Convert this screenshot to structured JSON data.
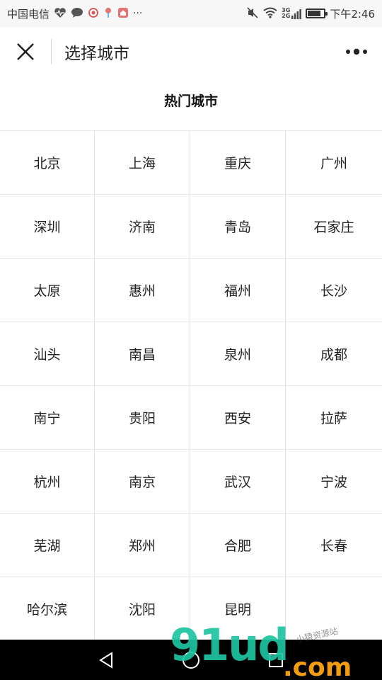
{
  "status_bar": {
    "carrier": "中国电信",
    "icons_left": [
      "heart-rate-icon",
      "chat-bubble-icon",
      "weibo-icon",
      "map-pin-icon",
      "home-app-icon",
      "more-dots-icon"
    ],
    "ellipsis": "···",
    "icons_right": [
      "mute-icon",
      "wifi-icon",
      "signal-3g-4g-icon",
      "battery-icon"
    ],
    "signal_label_top": "3G",
    "signal_label_bottom": "2G",
    "battery_level": 0.8,
    "time": "下午2:46"
  },
  "header": {
    "title": "选择城市",
    "close_icon": "close-icon",
    "more_icon": "more-dots-icon"
  },
  "section": {
    "title": "热门城市"
  },
  "cities": [
    "北京",
    "上海",
    "重庆",
    "广州",
    "深圳",
    "济南",
    "青岛",
    "石家庄",
    "太原",
    "惠州",
    "福州",
    "长沙",
    "汕头",
    "南昌",
    "泉州",
    "成都",
    "南宁",
    "贵阳",
    "西安",
    "拉萨",
    "杭州",
    "南京",
    "武汉",
    "宁波",
    "芜湖",
    "郑州",
    "合肥",
    "长春",
    "哈尔滨",
    "沈阳",
    "昆明"
  ],
  "nav_bar": {
    "back_icon": "back-triangle-icon",
    "home_icon": "home-circle-icon",
    "recents_icon": "recents-square-icon"
  },
  "watermark": {
    "main": "91ud",
    "suffix": ".com",
    "tagline": "小猿资源站"
  }
}
